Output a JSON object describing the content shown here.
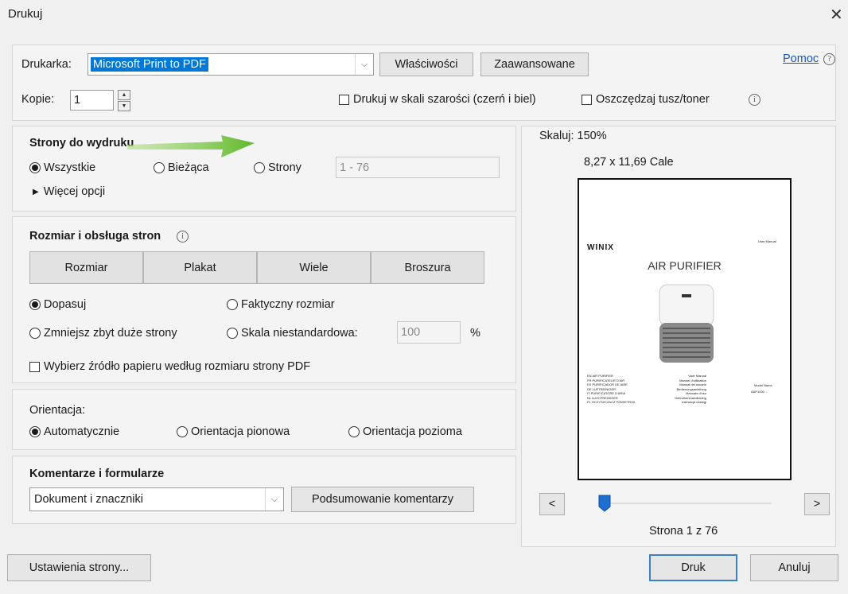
{
  "window": {
    "title": "Drukuj",
    "close_icon": "close-icon"
  },
  "printer": {
    "label": "Drukarka:",
    "selected": "Microsoft Print to PDF",
    "properties_button": "Właściwości",
    "advanced_button": "Zaawansowane",
    "help_link": "Pomoc",
    "copies_label": "Kopie:",
    "copies_value": "1",
    "grayscale_label": "Drukuj w skali szarości (czerń i biel)",
    "save_ink_label": "Oszczędzaj tusz/toner"
  },
  "pages_to_print": {
    "title": "Strony do wydruku",
    "all": "Wszystkie",
    "current": "Bieżąca",
    "pages": "Strony",
    "range_placeholder": "1 - 76",
    "more_options": "Więcej opcji",
    "selected": "all"
  },
  "page_sizing": {
    "title": "Rozmiar i obsługa stron",
    "buttons": [
      "Rozmiar",
      "Plakat",
      "Wiele",
      "Broszura"
    ],
    "fit": "Dopasuj",
    "actual_size": "Faktyczny rozmiar",
    "shrink_oversized": "Zmniejsz zbyt duże strony",
    "custom_scale": "Skala niestandardowa:",
    "custom_scale_value": "100",
    "percent": "%",
    "paper_source": "Wybierz źródło papieru według rozmiaru strony PDF"
  },
  "orientation": {
    "title": "Orientacja:",
    "auto": "Automatycznie",
    "portrait": "Orientacja pionowa",
    "landscape": "Orientacja pozioma"
  },
  "comments": {
    "title": "Komentarze i formularze",
    "selected": "Dokument i znaczniki",
    "summary_button": "Podsumowanie komentarzy"
  },
  "preview": {
    "scale": "Skaluj: 150%",
    "size": "8,27 x 11,69 Cale",
    "page_indicator": "Strona 1 z 76",
    "prev": "<",
    "next": ">",
    "slider_position": 0.0,
    "doc": {
      "brand": "WINIX",
      "user_manual": "User Manual",
      "product": "AIR PURIFIER",
      "languages": [
        [
          "EN  AIR PURIFIER",
          "User Manual"
        ],
        [
          "FR  PURIFICATEUR D'AIR",
          "Manuel d'utilisation"
        ],
        [
          "ES  PURIFICADOR DE AIRE",
          "Manual del usuario"
        ],
        [
          "DE  LUFTREINIGER",
          "Bedienungsanleitung"
        ],
        [
          "IT  PURIFICATORE D'ARIA",
          "Manuale d'uso"
        ],
        [
          "NL  LUCHTREINIGER",
          "Gebruikershandleiding"
        ],
        [
          "PL  OCZYSZCZACZ POWIETRZA",
          "Instrukcja obsługi"
        ]
      ],
      "model_label": "Model Name",
      "model_value": "AAP1000 ..."
    }
  },
  "footer": {
    "page_setup": "Ustawienia strony...",
    "print": "Druk",
    "cancel": "Anuluj"
  },
  "colors": {
    "accent": "#0078d7",
    "arrow": "#7ac943",
    "link": "#1a56b7"
  }
}
